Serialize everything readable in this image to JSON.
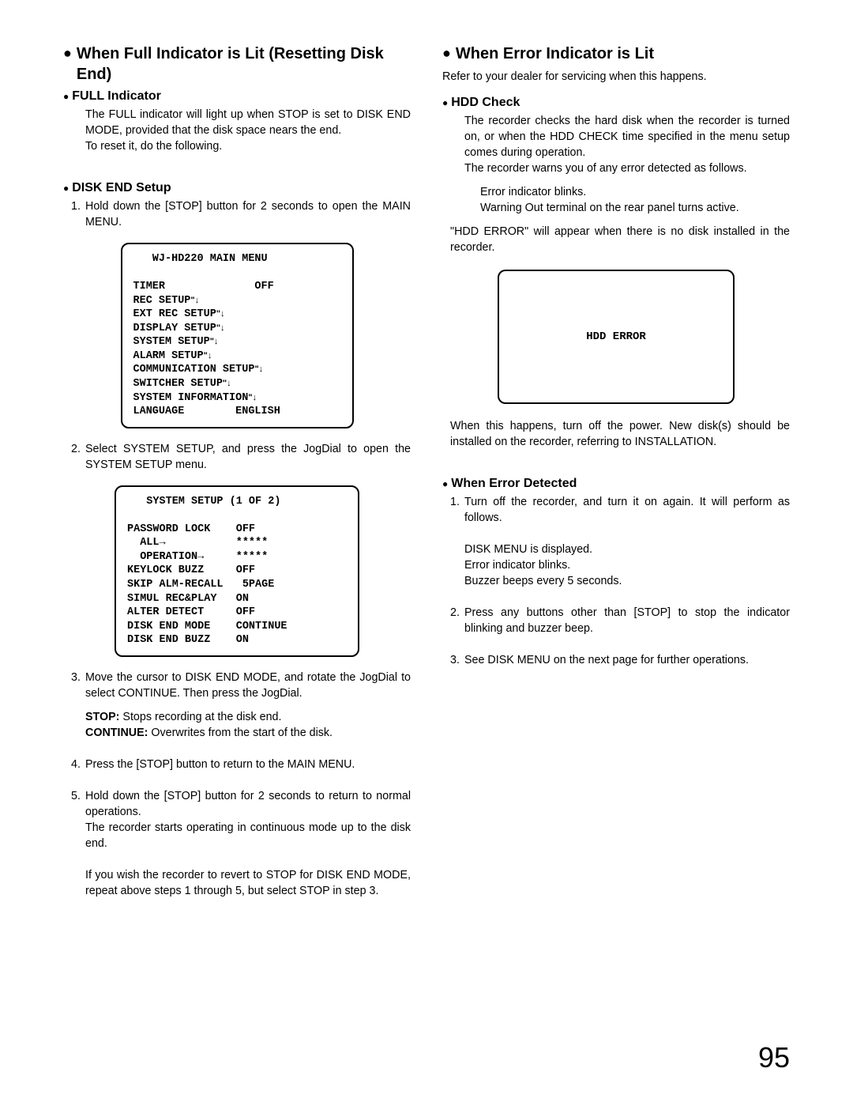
{
  "left": {
    "h1": "When Full Indicator is Lit (Resetting Disk End)",
    "full_indicator_heading": "FULL Indicator",
    "full_indicator_p1": "The FULL indicator will light up when STOP is set to DISK END MODE, provided that the disk space nears the end.",
    "full_indicator_p2": "To reset it, do the following.",
    "disk_end_heading": "DISK END Setup",
    "step1": "Hold down the [STOP] button for 2 seconds to open the MAIN MENU.",
    "menu1_title": "   WJ-HD220 MAIN MENU",
    "menu1_lines": [
      "TIMER              OFF",
      "REC SETUP",
      "EXT REC SETUP",
      "DISPLAY SETUP",
      "SYSTEM SETUP",
      "ALARM SETUP",
      "COMMUNICATION SETUP",
      "SWITCHER SETUP",
      "SYSTEM INFORMATION",
      "LANGUAGE        ENGLISH"
    ],
    "step2": "Select SYSTEM SETUP, and press the JogDial to open the SYSTEM SETUP menu.",
    "menu2_title": "   SYSTEM SETUP (1 OF 2)",
    "menu2_lines": [
      "PASSWORD LOCK    OFF",
      "  ALL→           *****",
      "  OPERATION→     *****",
      "KEYLOCK BUZZ     OFF",
      "SKIP ALM-RECALL   5PAGE",
      "SIMUL REC&PLAY   ON",
      "ALTER DETECT     OFF",
      "DISK END MODE    CONTINUE",
      "DISK END BUZZ    ON"
    ],
    "step3": "Move the cursor to DISK END MODE, and rotate the JogDial to select CONTINUE. Then press the JogDial.",
    "stop_label": "STOP:",
    "stop_text": " Stops recording at the disk end.",
    "continue_label": "CONTINUE:",
    "continue_text": " Overwrites from the start of the disk.",
    "step4": "Press the [STOP] button to return to the MAIN MENU.",
    "step5a": "Hold down the [STOP] button for 2 seconds to return to normal operations.",
    "step5b": "The recorder starts operating in continuous mode up to the disk end.",
    "step5c": "If you wish the recorder to revert to STOP for DISK END MODE, repeat above steps 1 through 5, but select STOP in step 3."
  },
  "right": {
    "h1": "When Error Indicator is Lit",
    "intro": "Refer to your dealer for servicing when this happens.",
    "hdd_heading": "HDD Check",
    "hdd_p1": "The recorder checks the hard disk when the recorder is turned on, or when the HDD CHECK time specified in the menu setup comes during operation.",
    "hdd_p2": "The recorder warns you of any error detected as follows.",
    "hdd_b1": "Error indicator blinks.",
    "hdd_b2": "Warning Out terminal on the rear panel turns active.",
    "hdd_p3": "\"HDD ERROR\" will appear when there is no disk installed in the recorder.",
    "hdd_box": "HDD ERROR",
    "hdd_p4": "When this happens, turn off the power. New disk(s) should be installed on the recorder, referring to INSTALLATION.",
    "err_heading": "When Error Detected",
    "err1a": "Turn off the recorder, and turn it on again. It will perform as follows.",
    "err1b1": "DISK MENU is displayed.",
    "err1b2": "Error indicator blinks.",
    "err1b3": "Buzzer beeps every 5 seconds.",
    "err2": "Press any buttons other than [STOP] to stop the indicator blinking and buzzer beep.",
    "err3": "See DISK MENU on the next page for further operations."
  },
  "page_number": "95"
}
